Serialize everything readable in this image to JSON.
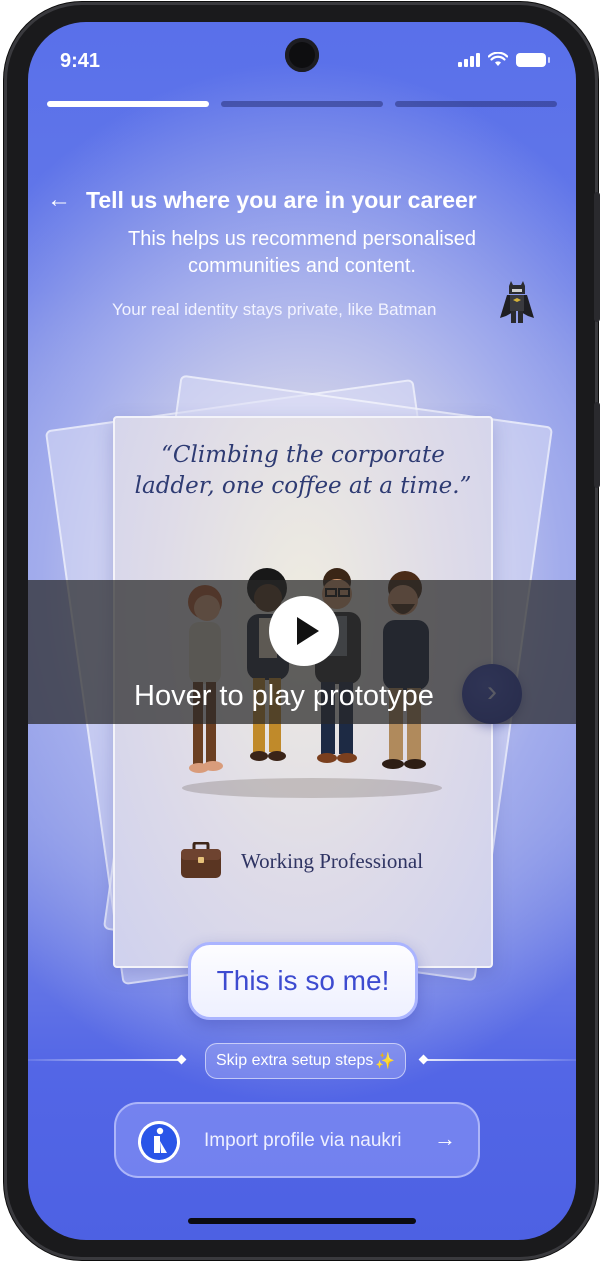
{
  "status_bar": {
    "time": "9:41"
  },
  "onboarding": {
    "steps_total": 3,
    "current_step": 1
  },
  "header": {
    "back_icon": "←",
    "title": "Tell us where you are in your career",
    "subtitle_line1": "This helps us recommend personalised",
    "subtitle_line2": "communities and content.",
    "privacy_note": "Your real identity stays private, like Batman"
  },
  "card": {
    "quote_line1": "“Climbing the corporate",
    "quote_line2": "ladder, one coffee at a time.”",
    "role_label": "Working Professional",
    "role_icon": "briefcase-icon",
    "illustration": "four-colleagues-chatting"
  },
  "next_icon": "›",
  "prototype_overlay": {
    "label": "Hover to play prototype"
  },
  "cta": {
    "label": "This is so me!"
  },
  "skip": {
    "label": "Skip extra setup steps",
    "sparkle": "✨"
  },
  "import": {
    "label": "Import profile via naukri",
    "arrow": "→"
  },
  "colors": {
    "background_top": "#5970ea",
    "background_bottom": "#4d61e3",
    "accent_text": "#3d4bd0",
    "quote_text": "#2e3b73",
    "next_button": "#2534a5"
  }
}
